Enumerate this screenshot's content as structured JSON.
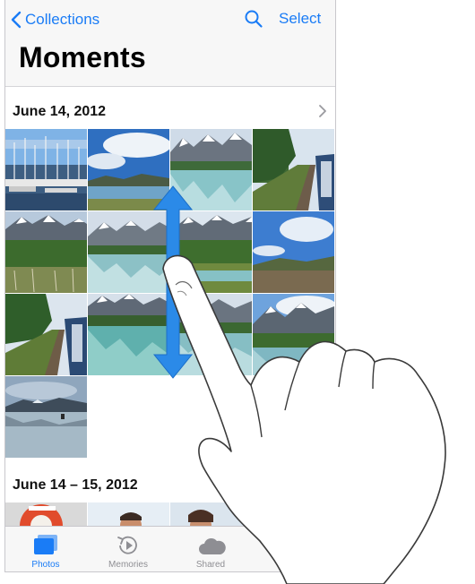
{
  "nav": {
    "back_label": "Collections",
    "select_label": "Select",
    "title": "Moments",
    "accent": "#1a7cf6"
  },
  "sections": [
    {
      "title": "June 14, 2012",
      "photo_count_visible": 13
    },
    {
      "title": "June 14 – 15, 2012"
    }
  ],
  "photos": [
    "marina-harbor",
    "mountain-lake-sky",
    "snowy-mountain-reflection",
    "railway-along-coast",
    "grassy-mountain-valley",
    "lake-mountain-reflection",
    "mountain-lake-meadow",
    "mountain-shore-clouds",
    "railway-curve",
    "turquoise-lake-mountains",
    "lake-mountains",
    "mountain-lake-clouds",
    "cloudy-lake-shore"
  ],
  "tabbar": {
    "tabs": [
      {
        "label": "Photos",
        "icon": "photos-icon",
        "active": true
      },
      {
        "label": "Memories",
        "icon": "memories-icon",
        "active": false
      },
      {
        "label": "Shared",
        "icon": "shared-cloud-icon",
        "active": false
      }
    ],
    "active_color": "#1a7cf6",
    "inactive_color": "#8e8e93"
  },
  "gesture": {
    "icon": "hand-pointer-icon",
    "arrow": "vertical-scroll-arrow"
  }
}
